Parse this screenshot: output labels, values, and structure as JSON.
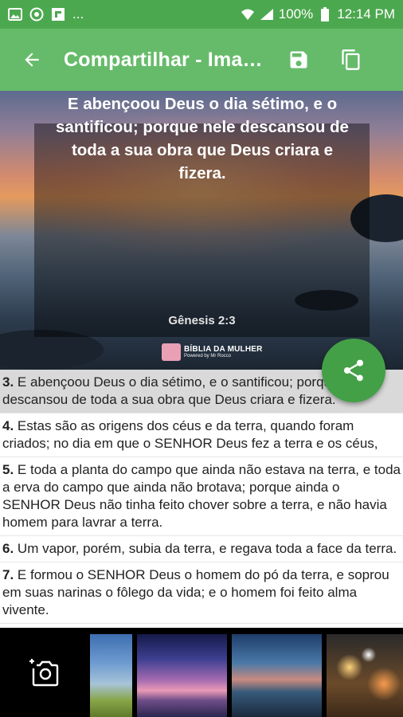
{
  "status_bar": {
    "more_indicator": "...",
    "battery_percent": "100%",
    "time": "12:14 PM"
  },
  "app_bar": {
    "title": "Compartilhar - Imagem"
  },
  "preview": {
    "verse_text": "E abençoou Deus o dia sétimo, e o santificou; porque nele descansou de toda a sua obra que Deus criara e fizera.",
    "reference": "Gênesis 2:3",
    "logo_text": "BÍBLIA DA MULHER",
    "logo_subtext": "Powered by Mr Rocco"
  },
  "verses": [
    {
      "num": "3.",
      "text": "E abençoou Deus o dia sétimo, e o santificou; porque nele descansou de toda a sua obra que Deus criara e fizera.",
      "selected": true
    },
    {
      "num": "4.",
      "text": "Estas são as origens dos céus e da terra, quando foram criados; no dia em que o SENHOR Deus fez a terra e os céus,",
      "selected": false
    },
    {
      "num": "5.",
      "text": "E toda a planta do campo que ainda não estava na terra, e toda a erva do campo que ainda não brotava; porque ainda o SENHOR Deus não tinha feito chover sobre a terra, e não havia homem para lavrar a terra.",
      "selected": false
    },
    {
      "num": "6.",
      "text": "Um vapor, porém, subia da terra, e regava toda a face da terra.",
      "selected": false
    },
    {
      "num": "7.",
      "text": "E formou o SENHOR Deus o homem do pó da terra, e soprou em suas narinas o fôlego da vida; e o homem foi feito alma vivente.",
      "selected": false
    }
  ],
  "icons": {
    "back": "arrow-back-icon",
    "save": "save-icon",
    "copy": "copy-icon",
    "share": "share-icon",
    "camera": "add-photo-icon"
  },
  "colors": {
    "status_bar": "#4ca84f",
    "app_bar": "#66bb6a",
    "fab": "#43a047",
    "selected_verse": "#d9d9d9"
  }
}
